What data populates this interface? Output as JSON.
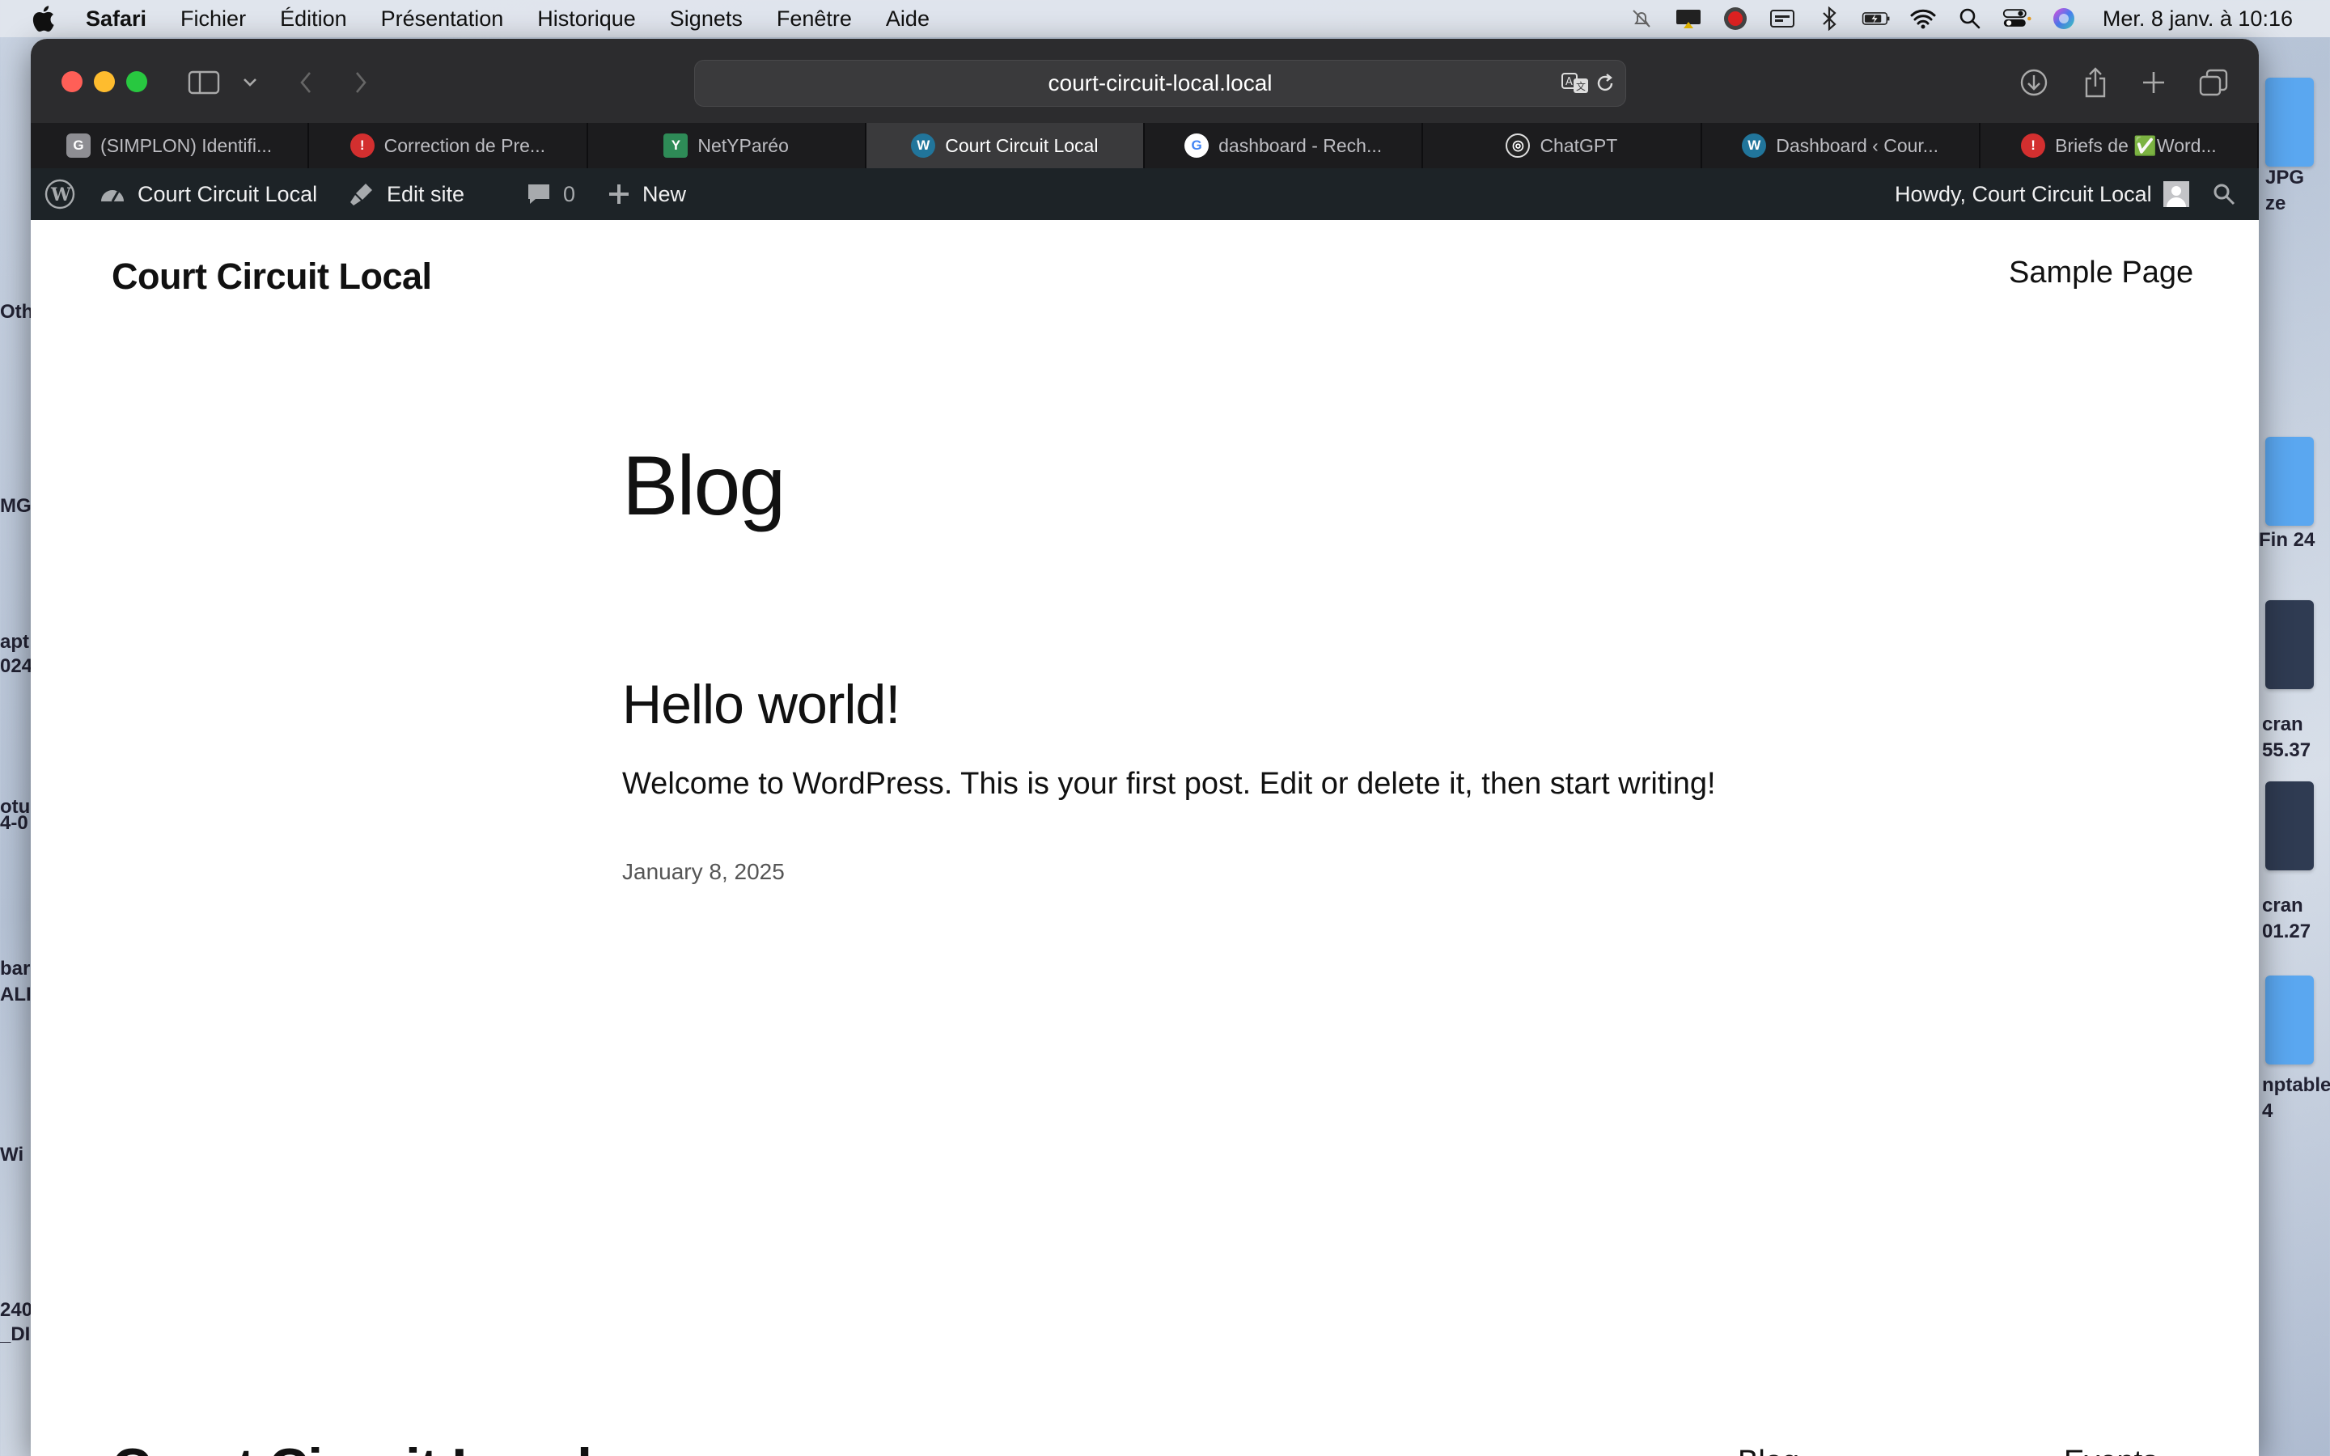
{
  "menubar": {
    "app_name": "Safari",
    "menus": [
      "Fichier",
      "Édition",
      "Présentation",
      "Historique",
      "Signets",
      "Fenêtre",
      "Aide"
    ],
    "clock": "Mer. 8 janv. à 10:16"
  },
  "desktop": {
    "labels": [
      "JPG",
      "ze",
      "Fin 24",
      "cran",
      "55.37",
      "cran",
      "01.27",
      "nptable",
      "4",
      "Oth",
      "MG",
      "apt",
      "024",
      "otu",
      "4-0",
      "bar",
      "ALI",
      "Wi",
      "240",
      "_DI"
    ]
  },
  "browser": {
    "url": "court-circuit-local.local",
    "tabs": [
      {
        "label": "(SIMPLON) Identifi...",
        "favicon": "G",
        "color": "#8e8e93",
        "active": false
      },
      {
        "label": "Correction de Pre...",
        "favicon": "!",
        "color": "#d32f2f",
        "active": false
      },
      {
        "label": "NetYParéo",
        "favicon": "Y",
        "color": "#2e8b57",
        "active": false
      },
      {
        "label": "Court Circuit Local",
        "favicon": "W",
        "color": "#21759b",
        "active": true
      },
      {
        "label": "dashboard - Rech...",
        "favicon": "G",
        "color": "#4285f4",
        "active": false
      },
      {
        "label": "ChatGPT",
        "favicon": "◎",
        "color": "#222222",
        "active": false
      },
      {
        "label": "Dashboard ‹ Cour...",
        "favicon": "W",
        "color": "#21759b",
        "active": false
      },
      {
        "label": "Briefs de ✅Word...",
        "favicon": "!",
        "color": "#d32f2f",
        "active": false
      }
    ]
  },
  "adminbar": {
    "site_name": "Court Circuit Local",
    "edit_site": "Edit site",
    "comments_count": "0",
    "new_label": "New",
    "howdy": "Howdy, Court Circuit Local"
  },
  "page": {
    "site_title": "Court Circuit Local",
    "nav": {
      "sample_page": "Sample Page"
    },
    "heading": "Blog",
    "post": {
      "title": "Hello world!",
      "excerpt": "Welcome to WordPress. This is your first post. Edit or delete it, then start writing!",
      "date": "January 8, 2025"
    },
    "footer": {
      "site_title": "Court Circuit Local",
      "links": [
        "Blog",
        "Events"
      ]
    }
  },
  "colors": {
    "admin_bar": "#1d2327",
    "safari_toolbar": "#2c2c2e",
    "close": "#ff5f57",
    "minimize": "#febc2e",
    "zoom": "#28c840"
  }
}
